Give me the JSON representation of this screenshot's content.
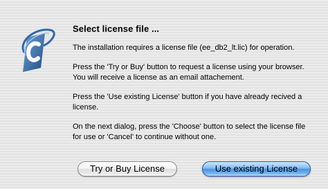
{
  "dialog": {
    "title": "Select license file  ...",
    "paragraphs": [
      "The installation requires a license file (ee_db2_lt.lic) for operation.",
      "Press the 'Try or Buy' button to request a license using your browser. You will receive a license as an email attachement.",
      "Press the 'Use existing License' button if you have already recived a license.",
      "On the next dialog, press the 'Choose' button to select the license file for use or 'Cancel' to continue without one."
    ],
    "buttons": {
      "try_or_buy": "Try or Buy License",
      "use_existing": "Use existing License"
    },
    "icon": "application-logo-icon",
    "colors": {
      "default_button": "#4b94e2",
      "logo_blue": "#2f6aa8"
    }
  }
}
